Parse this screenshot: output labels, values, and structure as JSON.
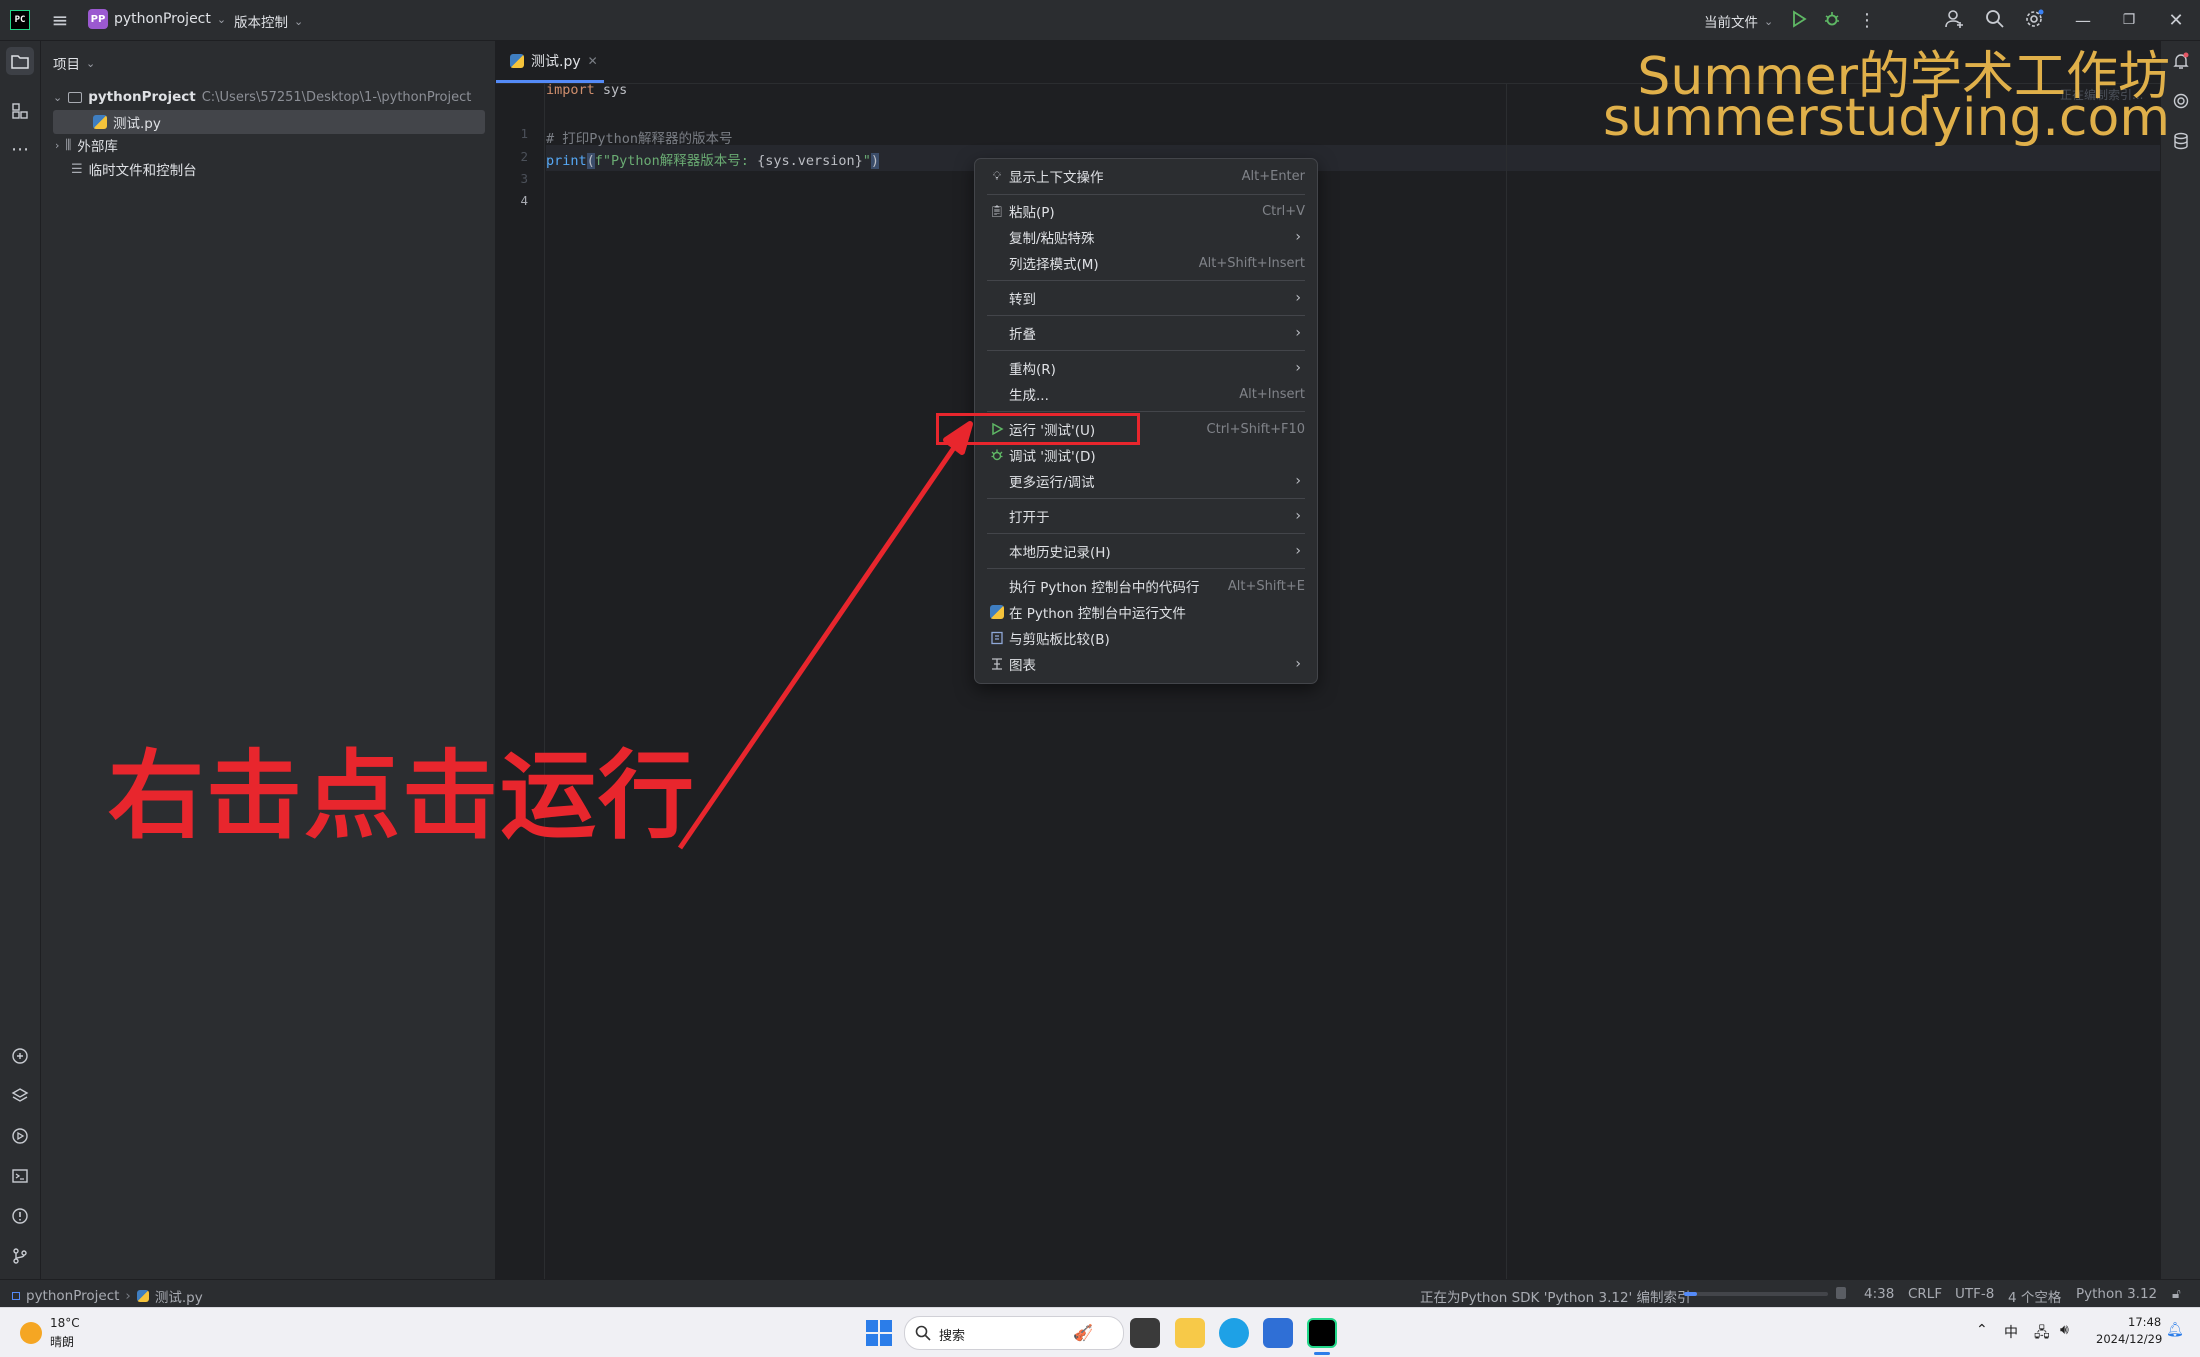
{
  "titlebar": {
    "project_badge": "PP",
    "project_name": "pythonProject",
    "vcs_label": "版本控制",
    "run_config": "当前文件",
    "logo": "PC"
  },
  "project_panel": {
    "title": "项目",
    "root_name": "pythonProject",
    "root_path": "C:\\Users\\57251\\Desktop\\1-\\pythonProject",
    "file_name": "测试.py",
    "external_libs": "外部库",
    "scratches": "临时文件和控制台"
  },
  "editor": {
    "tab_name": "测试.py",
    "line_numbers": [
      "1",
      "2",
      "3",
      "4"
    ],
    "code": {
      "l1_kw": "import",
      "l1_rest": " sys",
      "l3_comment": "# 打印Python解释器的版本号",
      "l4_fn": "print",
      "l4_open": "(",
      "l4_str1": "f\"Python解释器版本号: ",
      "l4_expr": "{sys.version}",
      "l4_str2": "\"",
      "l4_close": ")"
    }
  },
  "context_menu": {
    "items": [
      {
        "label": "显示上下文操作",
        "shortcut": "Alt+Enter",
        "icon": "bulb-icon"
      },
      {
        "label": "粘贴(P)",
        "shortcut": "Ctrl+V",
        "icon": "paste-icon"
      },
      {
        "label": "复制/粘贴特殊",
        "shortcut": "",
        "icon": ""
      },
      {
        "label": "列选择模式(M)",
        "shortcut": "Alt+Shift+Insert",
        "icon": ""
      },
      {
        "label": "转到",
        "shortcut": "",
        "icon": ""
      },
      {
        "label": "折叠",
        "shortcut": "",
        "icon": ""
      },
      {
        "label": "重构(R)",
        "shortcut": "",
        "icon": ""
      },
      {
        "label": "生成...",
        "shortcut": "Alt+Insert",
        "icon": ""
      },
      {
        "label": "运行 '测试'(U)",
        "shortcut": "Ctrl+Shift+F10",
        "icon": "run-icon"
      },
      {
        "label": "调试 '测试'(D)",
        "shortcut": "",
        "icon": "debug-icon"
      },
      {
        "label": "更多运行/调试",
        "shortcut": "",
        "icon": ""
      },
      {
        "label": "打开于",
        "shortcut": "",
        "icon": ""
      },
      {
        "label": "本地历史记录(H)",
        "shortcut": "",
        "icon": ""
      },
      {
        "label": "执行 Python 控制台中的代码行",
        "shortcut": "Alt+Shift+E",
        "icon": ""
      },
      {
        "label": "在 Python 控制台中运行文件",
        "shortcut": "",
        "icon": "python-icon"
      },
      {
        "label": "与剪贴板比较(B)",
        "shortcut": "",
        "icon": "compare-icon"
      },
      {
        "label": "图表",
        "shortcut": "",
        "icon": "diagram-icon"
      }
    ]
  },
  "annotation": {
    "text": "右击点击运行"
  },
  "watermark": {
    "line1": "Summer的学术工作坊",
    "line2": "summerstudying.com",
    "indexing_hint": "正在编制索引..."
  },
  "statusbar": {
    "crumb_project": "pythonProject",
    "crumb_file": "测试.py",
    "indexing_text": "正在为Python SDK 'Python 3.12' 编制索引",
    "indexing_progress": 0.09,
    "position": "4:38",
    "line_sep": "CRLF",
    "encoding": "UTF-8",
    "indent": "4 个空格",
    "interpreter": "Python 3.12"
  },
  "taskbar": {
    "weather_temp": "18°C",
    "weather_desc": "晴朗",
    "search_placeholder": "搜索",
    "ime": "中",
    "time": "17:48",
    "date": "2024/12/29"
  }
}
